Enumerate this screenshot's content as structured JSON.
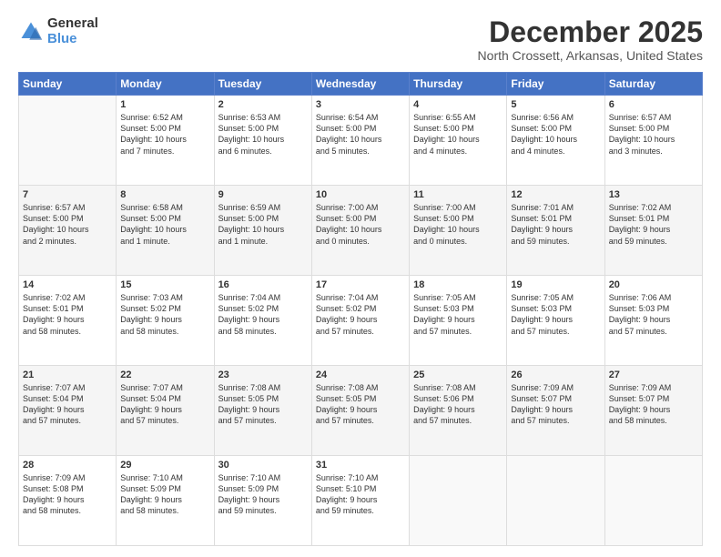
{
  "header": {
    "logo_general": "General",
    "logo_blue": "Blue",
    "month_title": "December 2025",
    "location": "North Crossett, Arkansas, United States"
  },
  "days_of_week": [
    "Sunday",
    "Monday",
    "Tuesday",
    "Wednesday",
    "Thursday",
    "Friday",
    "Saturday"
  ],
  "weeks": [
    [
      {
        "day": "",
        "info": ""
      },
      {
        "day": "1",
        "info": "Sunrise: 6:52 AM\nSunset: 5:00 PM\nDaylight: 10 hours\nand 7 minutes."
      },
      {
        "day": "2",
        "info": "Sunrise: 6:53 AM\nSunset: 5:00 PM\nDaylight: 10 hours\nand 6 minutes."
      },
      {
        "day": "3",
        "info": "Sunrise: 6:54 AM\nSunset: 5:00 PM\nDaylight: 10 hours\nand 5 minutes."
      },
      {
        "day": "4",
        "info": "Sunrise: 6:55 AM\nSunset: 5:00 PM\nDaylight: 10 hours\nand 4 minutes."
      },
      {
        "day": "5",
        "info": "Sunrise: 6:56 AM\nSunset: 5:00 PM\nDaylight: 10 hours\nand 4 minutes."
      },
      {
        "day": "6",
        "info": "Sunrise: 6:57 AM\nSunset: 5:00 PM\nDaylight: 10 hours\nand 3 minutes."
      }
    ],
    [
      {
        "day": "7",
        "info": "Sunrise: 6:57 AM\nSunset: 5:00 PM\nDaylight: 10 hours\nand 2 minutes."
      },
      {
        "day": "8",
        "info": "Sunrise: 6:58 AM\nSunset: 5:00 PM\nDaylight: 10 hours\nand 1 minute."
      },
      {
        "day": "9",
        "info": "Sunrise: 6:59 AM\nSunset: 5:00 PM\nDaylight: 10 hours\nand 1 minute."
      },
      {
        "day": "10",
        "info": "Sunrise: 7:00 AM\nSunset: 5:00 PM\nDaylight: 10 hours\nand 0 minutes."
      },
      {
        "day": "11",
        "info": "Sunrise: 7:00 AM\nSunset: 5:00 PM\nDaylight: 10 hours\nand 0 minutes."
      },
      {
        "day": "12",
        "info": "Sunrise: 7:01 AM\nSunset: 5:01 PM\nDaylight: 9 hours\nand 59 minutes."
      },
      {
        "day": "13",
        "info": "Sunrise: 7:02 AM\nSunset: 5:01 PM\nDaylight: 9 hours\nand 59 minutes."
      }
    ],
    [
      {
        "day": "14",
        "info": "Sunrise: 7:02 AM\nSunset: 5:01 PM\nDaylight: 9 hours\nand 58 minutes."
      },
      {
        "day": "15",
        "info": "Sunrise: 7:03 AM\nSunset: 5:02 PM\nDaylight: 9 hours\nand 58 minutes."
      },
      {
        "day": "16",
        "info": "Sunrise: 7:04 AM\nSunset: 5:02 PM\nDaylight: 9 hours\nand 58 minutes."
      },
      {
        "day": "17",
        "info": "Sunrise: 7:04 AM\nSunset: 5:02 PM\nDaylight: 9 hours\nand 57 minutes."
      },
      {
        "day": "18",
        "info": "Sunrise: 7:05 AM\nSunset: 5:03 PM\nDaylight: 9 hours\nand 57 minutes."
      },
      {
        "day": "19",
        "info": "Sunrise: 7:05 AM\nSunset: 5:03 PM\nDaylight: 9 hours\nand 57 minutes."
      },
      {
        "day": "20",
        "info": "Sunrise: 7:06 AM\nSunset: 5:03 PM\nDaylight: 9 hours\nand 57 minutes."
      }
    ],
    [
      {
        "day": "21",
        "info": "Sunrise: 7:07 AM\nSunset: 5:04 PM\nDaylight: 9 hours\nand 57 minutes."
      },
      {
        "day": "22",
        "info": "Sunrise: 7:07 AM\nSunset: 5:04 PM\nDaylight: 9 hours\nand 57 minutes."
      },
      {
        "day": "23",
        "info": "Sunrise: 7:08 AM\nSunset: 5:05 PM\nDaylight: 9 hours\nand 57 minutes."
      },
      {
        "day": "24",
        "info": "Sunrise: 7:08 AM\nSunset: 5:05 PM\nDaylight: 9 hours\nand 57 minutes."
      },
      {
        "day": "25",
        "info": "Sunrise: 7:08 AM\nSunset: 5:06 PM\nDaylight: 9 hours\nand 57 minutes."
      },
      {
        "day": "26",
        "info": "Sunrise: 7:09 AM\nSunset: 5:07 PM\nDaylight: 9 hours\nand 57 minutes."
      },
      {
        "day": "27",
        "info": "Sunrise: 7:09 AM\nSunset: 5:07 PM\nDaylight: 9 hours\nand 58 minutes."
      }
    ],
    [
      {
        "day": "28",
        "info": "Sunrise: 7:09 AM\nSunset: 5:08 PM\nDaylight: 9 hours\nand 58 minutes."
      },
      {
        "day": "29",
        "info": "Sunrise: 7:10 AM\nSunset: 5:09 PM\nDaylight: 9 hours\nand 58 minutes."
      },
      {
        "day": "30",
        "info": "Sunrise: 7:10 AM\nSunset: 5:09 PM\nDaylight: 9 hours\nand 59 minutes."
      },
      {
        "day": "31",
        "info": "Sunrise: 7:10 AM\nSunset: 5:10 PM\nDaylight: 9 hours\nand 59 minutes."
      },
      {
        "day": "",
        "info": ""
      },
      {
        "day": "",
        "info": ""
      },
      {
        "day": "",
        "info": ""
      }
    ]
  ]
}
